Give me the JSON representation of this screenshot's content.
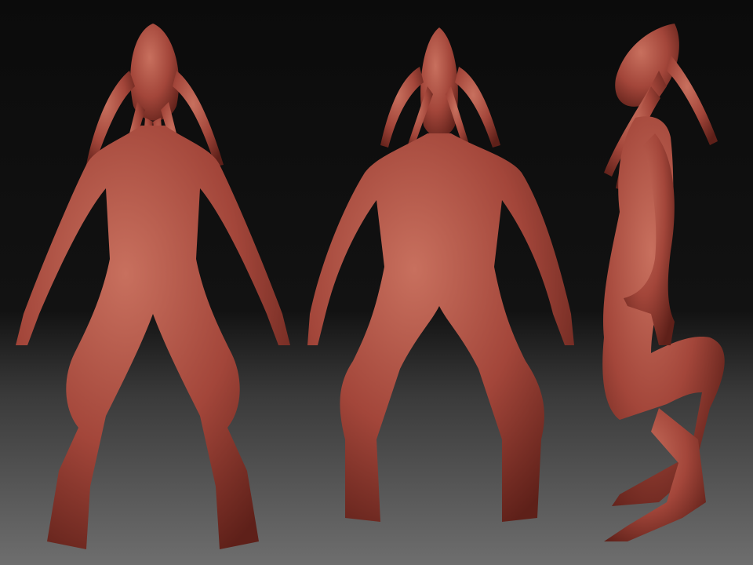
{
  "scene": {
    "subject": "creature-sculpt-turnaround",
    "views": [
      "front",
      "back",
      "side"
    ],
    "colors": {
      "skin": "#a3463a",
      "skin_highlight": "#c8705e",
      "skin_shadow": "#5e2019",
      "background_top": "#0b0b0b",
      "background_bottom": "#6e6e6e"
    }
  }
}
